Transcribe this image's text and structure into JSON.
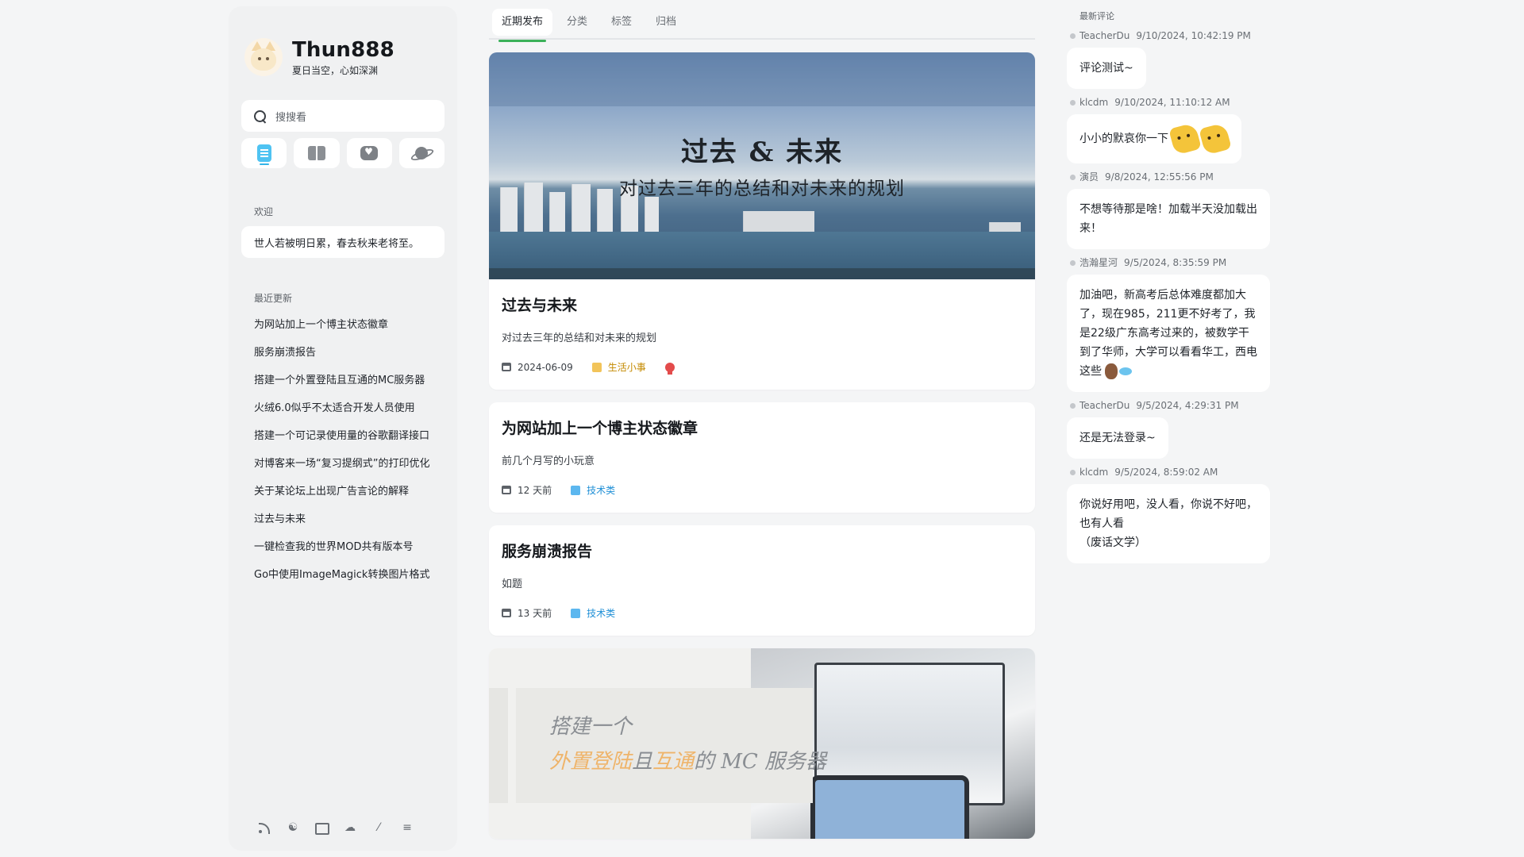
{
  "sidebar": {
    "site_name": "Thun888",
    "motto": "夏日当空，心如深渊",
    "search_placeholder": "搜搜看",
    "nav_icons": [
      "doc-icon",
      "book-icon",
      "chat-heart-icon",
      "planet-icon"
    ],
    "welcome_label": "欢迎",
    "welcome_text": "世人若被明日累，春去秋来老将至。",
    "recent_label": "最近更新",
    "recent_items": [
      "为网站加上一个博主状态徽章",
      "服务崩溃报告",
      "搭建一个外置登陆且互通的MC服务器",
      "火绒6.0似乎不太适合开发人员使用",
      "搭建一个可记录使用量的谷歌翻译接口",
      "对博客来一场“复习提纲式”的打印优化",
      "关于某论坛上出现广告言论的解释",
      "过去与未来",
      "一键检查我的世界MOD共有版本号",
      "Go中使用ImageMagick转换图片格式"
    ],
    "social_icons": [
      "rss-icon",
      "github-icon",
      "mail-icon",
      "cloud-icon",
      "slash-icon",
      "list-icon"
    ]
  },
  "main": {
    "tabs": [
      "近期发布",
      "分类",
      "标签",
      "归档"
    ],
    "posts": [
      {
        "cover_title": "过去 & 未来",
        "cover_subtitle": "对过去三年的总结和对未来的规划",
        "title": "过去与未来",
        "desc": "对过去三年的总结和对未来的规划",
        "date": "2024-06-09",
        "category": "生活小事"
      },
      {
        "title": "为网站加上一个博主状态徽章",
        "desc": "前几个月写的小玩意",
        "date": "12 天前",
        "category": "技术类"
      },
      {
        "title": "服务崩溃报告",
        "desc": "如题",
        "date": "13 天前",
        "category": "技术类"
      },
      {
        "cover_line1": "搭建一个",
        "cover_line2_a": "外置登陆",
        "cover_line2_b": "且",
        "cover_line2_c": "互通",
        "cover_line2_d": "的 MC 服务器"
      }
    ]
  },
  "comments": {
    "label": "最新评论",
    "items": [
      {
        "author": "TeacherDu",
        "time": "9/10/2024, 10:42:19 PM",
        "text": "评论测试~"
      },
      {
        "author": "klcdm",
        "time": "9/10/2024, 11:10:12 AM",
        "text": "小小的默哀你一下"
      },
      {
        "author": "演员",
        "time": "9/8/2024, 12:55:56 PM",
        "text": "不想等待那是啥！加载半天没加载出来！"
      },
      {
        "author": "浩瀚星河",
        "time": "9/5/2024, 8:35:59 PM",
        "text": "加油吧，新高考后总体难度都加大了，现在985，211更不好考了，我是22级广东高考过来的，被数学干到了华师，大学可以看看华工，西电这些"
      },
      {
        "author": "TeacherDu",
        "time": "9/5/2024, 4:29:31 PM",
        "text": "还是无法登录~"
      },
      {
        "author": "klcdm",
        "time": "9/5/2024, 8:59:02 AM",
        "text": "你说好用吧，没人看，你说不好吧，也有人看\n（废话文学）"
      }
    ]
  }
}
